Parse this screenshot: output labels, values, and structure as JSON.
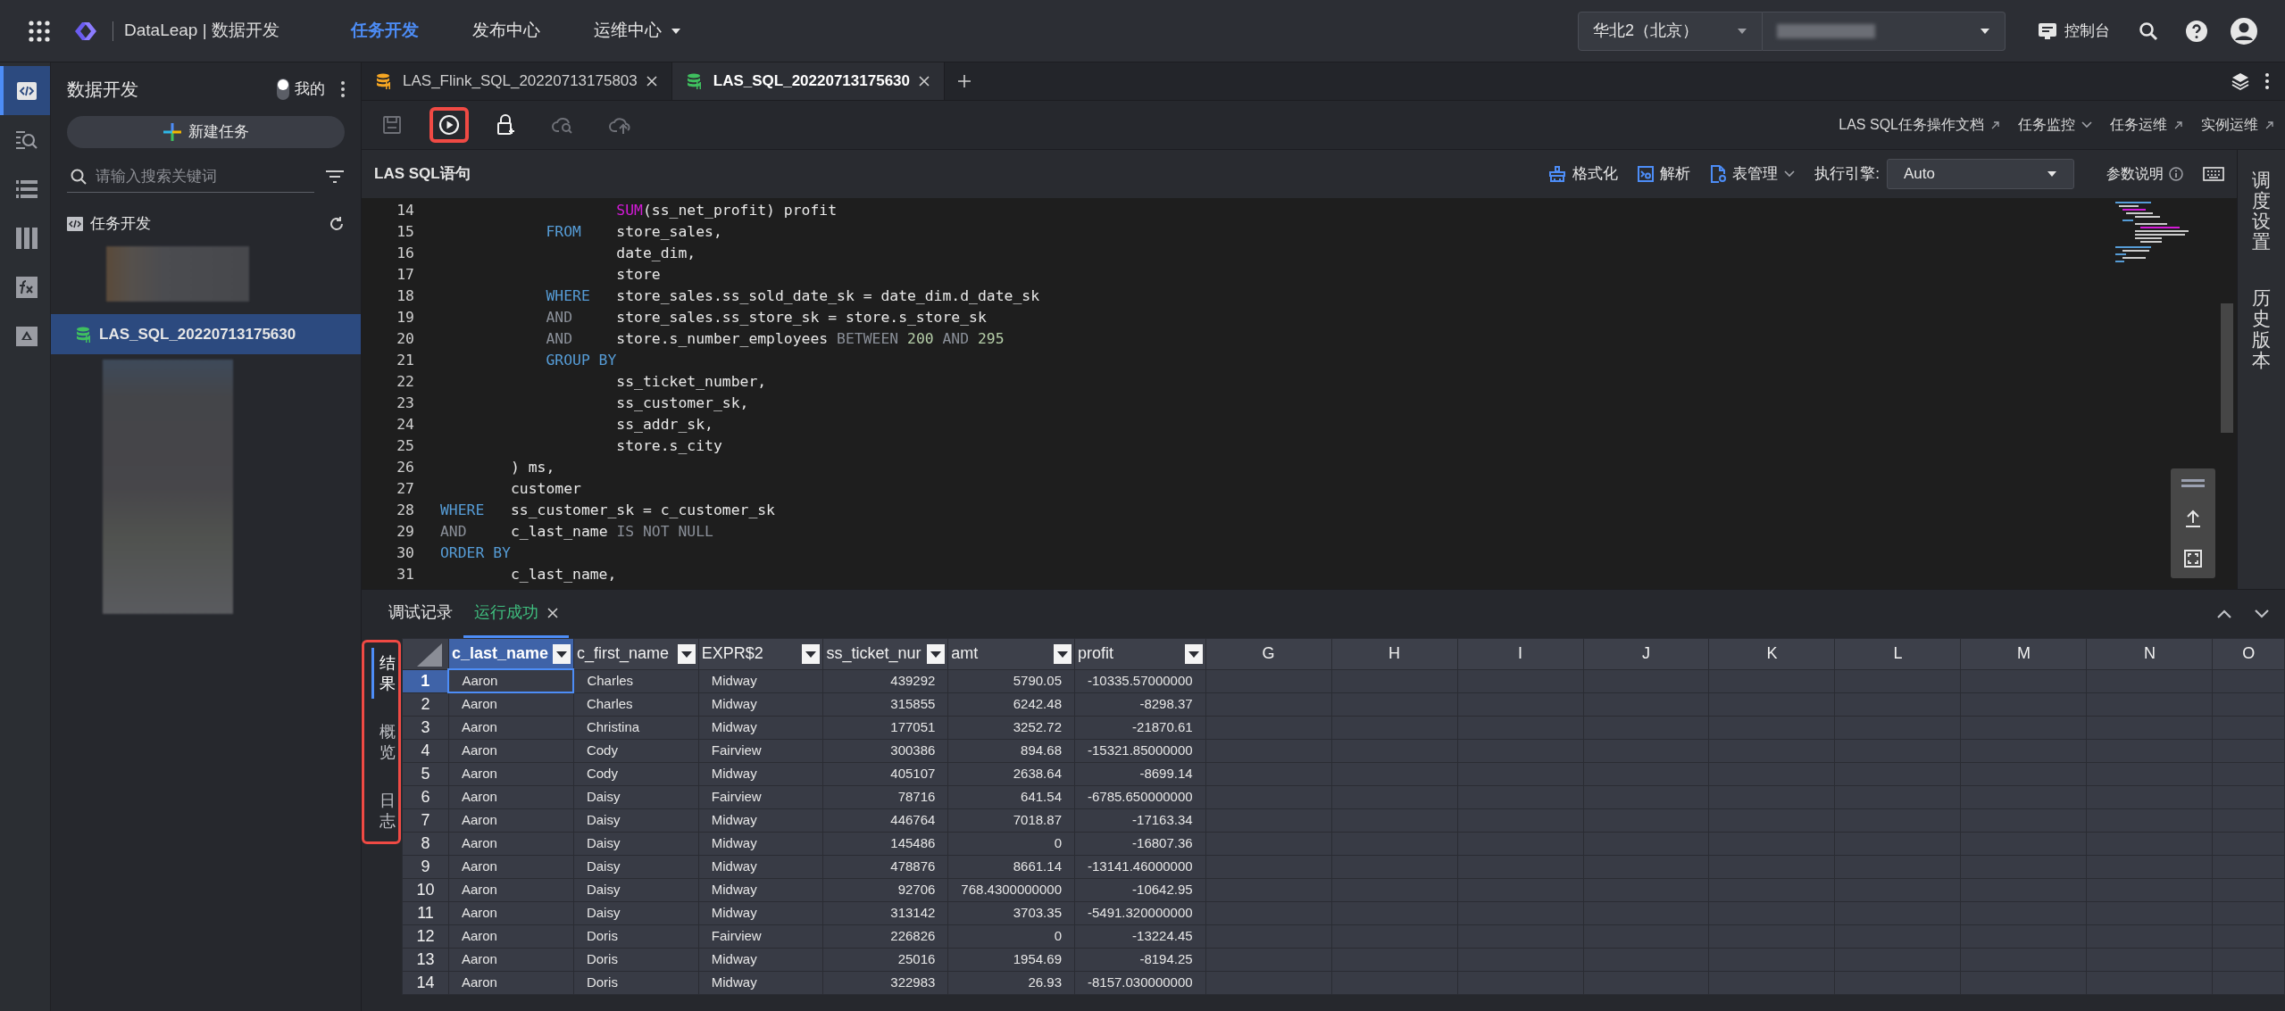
{
  "top_bar": {
    "brand": "DataLeap | 数据开发",
    "nav": [
      {
        "label": "任务开发",
        "selected": true,
        "dropdown": false
      },
      {
        "label": "发布中心",
        "selected": false,
        "dropdown": false
      },
      {
        "label": "运维中心",
        "selected": false,
        "dropdown": true
      }
    ],
    "region": "华北2（北京）",
    "console": "控制台"
  },
  "rail": [
    {
      "kind": "code",
      "selected": true
    },
    {
      "kind": "search-list",
      "selected": false
    },
    {
      "kind": "list",
      "selected": false
    },
    {
      "kind": "columns",
      "selected": false
    },
    {
      "kind": "fx",
      "selected": false
    },
    {
      "kind": "drive",
      "selected": false
    }
  ],
  "sidebar": {
    "title": "数据开发",
    "mine": {
      "label": "我的",
      "on": false
    },
    "new_task": "新建任务",
    "search": {
      "placeholder": "请输入搜索关键词"
    },
    "tree": {
      "label": "任务开发",
      "items": [
        {
          "label": "LAS_SQL_20220713175630",
          "selected": true
        }
      ]
    }
  },
  "editor_tabs": [
    {
      "label": "LAS_Flink_SQL_20220713175803",
      "kind": "flink",
      "selected": false
    },
    {
      "label": "LAS_SQL_20220713175630",
      "kind": "sql",
      "selected": true
    }
  ],
  "toolbar": {
    "tools": [
      {
        "kind": "save",
        "disabled": true,
        "highlighted": false
      },
      {
        "kind": "run",
        "disabled": false,
        "highlighted": true
      },
      {
        "kind": "lock",
        "disabled": false,
        "highlighted": false
      },
      {
        "kind": "cloud-search",
        "disabled": true,
        "highlighted": false
      },
      {
        "kind": "cloud-upload",
        "disabled": true,
        "highlighted": false
      }
    ],
    "links": [
      {
        "label": "LAS SQL任务操作文档",
        "kind": "external"
      },
      {
        "label": "任务监控",
        "kind": "dropdown"
      },
      {
        "label": "任务运维",
        "kind": "external"
      },
      {
        "label": "实例运维",
        "kind": "external"
      }
    ]
  },
  "editor": {
    "title": "LAS SQL语句",
    "actions": [
      {
        "label": "格式化",
        "kind": "format"
      },
      {
        "label": "解析",
        "kind": "parse"
      },
      {
        "label": "表管理",
        "kind": "tables"
      }
    ],
    "engine_label": "执行引擎:",
    "engine": "Auto",
    "params": "参数说明",
    "lines": [
      {
        "number": "14",
        "tokens": [
          {
            "text": "                    SUM",
            "kind": "function"
          },
          {
            "text": "(ss_net_profit) profit",
            "kind": "plain"
          }
        ]
      },
      {
        "number": "15",
        "tokens": [
          {
            "text": "            FROM",
            "kind": "keyword"
          },
          {
            "text": "    store_sales,",
            "kind": "plain"
          }
        ]
      },
      {
        "number": "16",
        "tokens": [
          {
            "text": "                    date_dim,",
            "kind": "plain"
          }
        ]
      },
      {
        "number": "17",
        "tokens": [
          {
            "text": "                    store",
            "kind": "plain"
          }
        ]
      },
      {
        "number": "18",
        "tokens": [
          {
            "text": "            WHERE",
            "kind": "keyword"
          },
          {
            "text": "   store_sales.ss_sold_date_sk = date_dim.d_date_sk",
            "kind": "plain"
          }
        ]
      },
      {
        "number": "19",
        "tokens": [
          {
            "text": "            AND",
            "kind": "operator"
          },
          {
            "text": "     store_sales.ss_store_sk = store.s_store_sk",
            "kind": "plain"
          }
        ]
      },
      {
        "number": "20",
        "tokens": [
          {
            "text": "            AND",
            "kind": "operator"
          },
          {
            "text": "     store.s_number_employees ",
            "kind": "plain"
          },
          {
            "text": "BETWEEN ",
            "kind": "operator"
          },
          {
            "text": "200 ",
            "kind": "number"
          },
          {
            "text": "AND ",
            "kind": "operator"
          },
          {
            "text": "295",
            "kind": "number"
          }
        ]
      },
      {
        "number": "21",
        "tokens": [
          {
            "text": "            GROUP BY",
            "kind": "keyword"
          }
        ]
      },
      {
        "number": "22",
        "tokens": [
          {
            "text": "                    ss_ticket_number,",
            "kind": "plain"
          }
        ]
      },
      {
        "number": "23",
        "tokens": [
          {
            "text": "                    ss_customer_sk,",
            "kind": "plain"
          }
        ]
      },
      {
        "number": "24",
        "tokens": [
          {
            "text": "                    ss_addr_sk,",
            "kind": "plain"
          }
        ]
      },
      {
        "number": "25",
        "tokens": [
          {
            "text": "                    store.s_city",
            "kind": "plain"
          }
        ]
      },
      {
        "number": "26",
        "tokens": [
          {
            "text": "        ) ms,",
            "kind": "plain"
          }
        ]
      },
      {
        "number": "27",
        "tokens": [
          {
            "text": "        customer",
            "kind": "plain"
          }
        ]
      },
      {
        "number": "28",
        "tokens": [
          {
            "text": "WHERE",
            "kind": "keyword"
          },
          {
            "text": "   ss_customer_sk = c_customer_sk",
            "kind": "plain"
          }
        ]
      },
      {
        "number": "29",
        "tokens": [
          {
            "text": "AND",
            "kind": "operator"
          },
          {
            "text": "     c_last_name ",
            "kind": "plain"
          },
          {
            "text": "IS NOT NULL",
            "kind": "operator"
          }
        ]
      },
      {
        "number": "30",
        "tokens": [
          {
            "text": "ORDER BY",
            "kind": "keyword"
          }
        ]
      },
      {
        "number": "31",
        "tokens": [
          {
            "text": "        c_last_name,",
            "kind": "plain"
          }
        ]
      }
    ]
  },
  "right_rail": [
    {
      "label": "调度设置"
    },
    {
      "label": "历史版本"
    }
  ],
  "results": {
    "tabs": [
      {
        "label": "调试记录",
        "kind": "history",
        "selected": false,
        "closable": false
      },
      {
        "label": "运行成功",
        "kind": "success",
        "selected": true,
        "closable": true
      }
    ],
    "side_tabs": [
      {
        "label": "结果",
        "selected": true
      },
      {
        "label": "概览",
        "selected": false
      },
      {
        "label": "日志",
        "selected": false
      }
    ],
    "side_tabs_highlighted": true,
    "columns": [
      {
        "label": "c_last_name",
        "kind": "text",
        "filter": true,
        "selected": true
      },
      {
        "label": "c_first_name",
        "kind": "text",
        "filter": true,
        "selected": false
      },
      {
        "label": "EXPR$2",
        "kind": "text",
        "filter": true,
        "selected": false
      },
      {
        "label": "ss_ticket_nur",
        "kind": "number",
        "filter": true,
        "selected": false
      },
      {
        "label": "amt",
        "kind": "number",
        "filter": true,
        "selected": false
      },
      {
        "label": "profit",
        "kind": "number",
        "filter": true,
        "selected": false
      },
      {
        "label": "G",
        "kind": "empty",
        "filter": false,
        "selected": false
      },
      {
        "label": "H",
        "kind": "empty",
        "filter": false,
        "selected": false
      },
      {
        "label": "I",
        "kind": "empty",
        "filter": false,
        "selected": false
      },
      {
        "label": "J",
        "kind": "empty",
        "filter": false,
        "selected": false
      },
      {
        "label": "K",
        "kind": "empty",
        "filter": false,
        "selected": false
      },
      {
        "label": "L",
        "kind": "empty",
        "filter": false,
        "selected": false
      },
      {
        "label": "M",
        "kind": "empty",
        "filter": false,
        "selected": false
      },
      {
        "label": "N",
        "kind": "empty",
        "filter": false,
        "selected": false
      },
      {
        "label": "O",
        "kind": "empty",
        "filter": false,
        "selected": false
      }
    ],
    "rows": [
      {
        "number": "1",
        "selected": true,
        "cells": [
          "Aaron",
          "Charles",
          "Midway",
          "439292",
          "5790.05",
          "-10335.57000000"
        ]
      },
      {
        "number": "2",
        "selected": false,
        "cells": [
          "Aaron",
          "Charles",
          "Midway",
          "315855",
          "6242.48",
          "-8298.37"
        ]
      },
      {
        "number": "3",
        "selected": false,
        "cells": [
          "Aaron",
          "Christina",
          "Midway",
          "177051",
          "3252.72",
          "-21870.61"
        ]
      },
      {
        "number": "4",
        "selected": false,
        "cells": [
          "Aaron",
          "Cody",
          "Fairview",
          "300386",
          "894.68",
          "-15321.85000000"
        ]
      },
      {
        "number": "5",
        "selected": false,
        "cells": [
          "Aaron",
          "Cody",
          "Midway",
          "405107",
          "2638.64",
          "-8699.14"
        ]
      },
      {
        "number": "6",
        "selected": false,
        "cells": [
          "Aaron",
          "Daisy",
          "Fairview",
          "78716",
          "641.54",
          "-6785.650000000"
        ]
      },
      {
        "number": "7",
        "selected": false,
        "cells": [
          "Aaron",
          "Daisy",
          "Midway",
          "446764",
          "7018.87",
          "-17163.34"
        ]
      },
      {
        "number": "8",
        "selected": false,
        "cells": [
          "Aaron",
          "Daisy",
          "Midway",
          "145486",
          "0",
          "-16807.36"
        ]
      },
      {
        "number": "9",
        "selected": false,
        "cells": [
          "Aaron",
          "Daisy",
          "Midway",
          "478876",
          "8661.14",
          "-13141.46000000"
        ]
      },
      {
        "number": "10",
        "selected": false,
        "cells": [
          "Aaron",
          "Daisy",
          "Midway",
          "92706",
          "768.4300000000",
          "-10642.95"
        ]
      },
      {
        "number": "11",
        "selected": false,
        "cells": [
          "Aaron",
          "Daisy",
          "Midway",
          "313142",
          "3703.35",
          "-5491.320000000"
        ]
      },
      {
        "number": "12",
        "selected": false,
        "cells": [
          "Aaron",
          "Doris",
          "Fairview",
          "226826",
          "0",
          "-13224.45"
        ]
      },
      {
        "number": "13",
        "selected": false,
        "cells": [
          "Aaron",
          "Doris",
          "Midway",
          "25016",
          "1954.69",
          "-8194.25"
        ]
      },
      {
        "number": "14",
        "selected": false,
        "cells": [
          "Aaron",
          "Doris",
          "Midway",
          "322983",
          "26.93",
          "-8157.030000000"
        ]
      }
    ]
  }
}
